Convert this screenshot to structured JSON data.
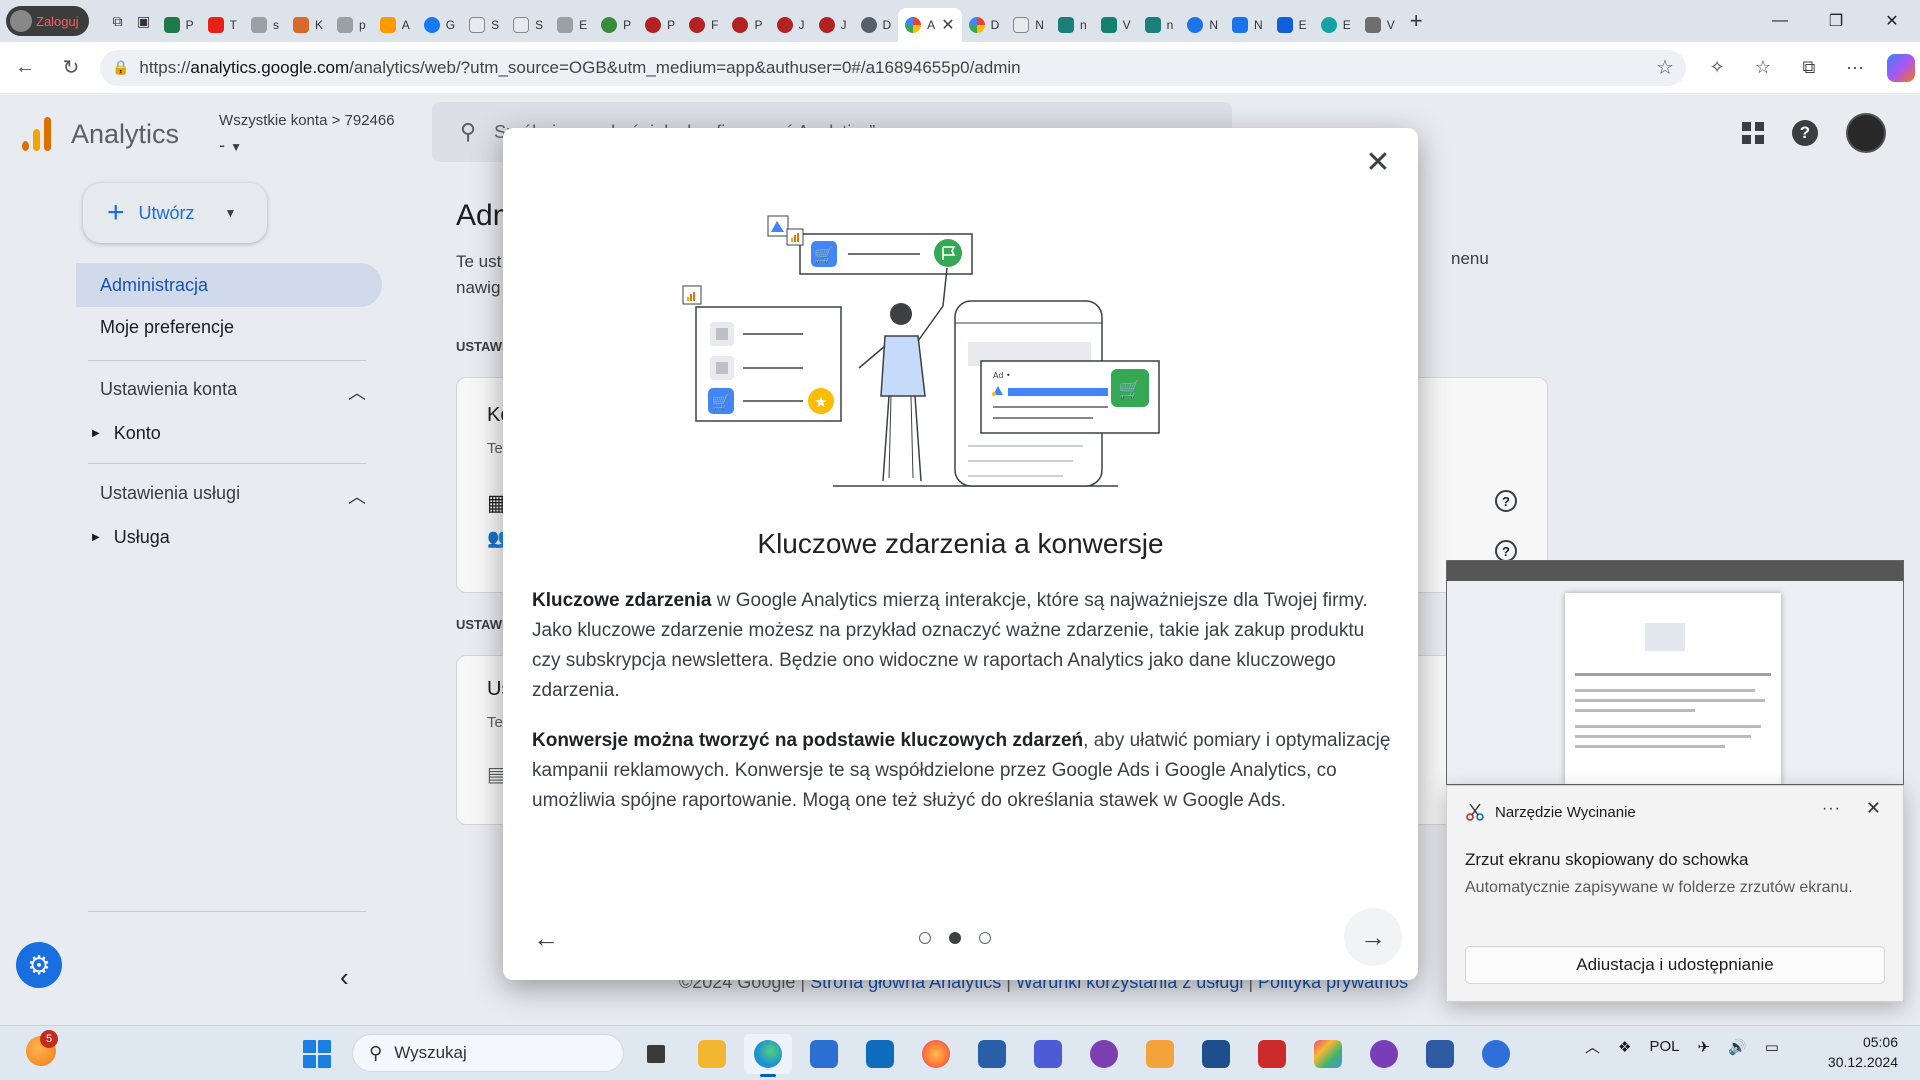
{
  "browser": {
    "profile_label": "Zaloguj",
    "pinned_tabs": [
      "P",
      "T",
      "s",
      "K",
      "p",
      "A",
      "G",
      "S",
      "S",
      "E",
      "P",
      "P",
      "F",
      "P",
      "J",
      "J",
      "D"
    ],
    "active_tab_title": "A",
    "right_tabs": [
      "D",
      "N",
      "n",
      "V",
      "n",
      "N",
      "N",
      "E",
      "E",
      "V"
    ],
    "url_prefix": "https://",
    "url_host": "analytics.google.com",
    "url_path": "/analytics/web/?utm_source=OGB&utm_medium=app&authuser=0#/a16894655p0/admin",
    "colors": {
      "tabstrip": "#dde3ea",
      "omnibox": "#edf0f4"
    }
  },
  "ga": {
    "app_title": "Analytics",
    "breadcrumb": "Wszystkie konta",
    "account_id": "792466",
    "property_value": "-",
    "search_placeholder": "Spróbuj wyszukać „jak skonfigurować Analytics”",
    "create_label": "Utwórz",
    "sidebar": {
      "admin": "Administracja",
      "prefs": "Moje preferencje",
      "account_settings": "Ustawienia konta",
      "account_item": "Konto",
      "service_settings": "Ustawienia usługi",
      "service_item": "Usługa"
    },
    "main": {
      "title_partial": "Adm",
      "desc_line1": "Te ust",
      "desc_line2": "nawig",
      "desc_right": "nenu",
      "section1": "USTAWI",
      "card1_title": "Ko",
      "card1_sub": "Te",
      "section2": "USTAWI",
      "card2_title": "Us",
      "card2_sub": "Te"
    },
    "footer": {
      "copyright": "©2024 Google",
      "link1": "Strona główna Analytics",
      "link2": "Warunki korzystania z usługi",
      "link3": "Polityka prywatnoś"
    },
    "accent_color": "#1a73e8"
  },
  "modal": {
    "title": "Kluczowe zdarzenia a konwersje",
    "p1_bold": "Kluczowe zdarzenia",
    "p1_rest": " w Google Analytics mierzą interakcje, które są najważniejsze dla Twojej firmy. Jako kluczowe zdarzenie możesz na przykład oznaczyć ważne zdarzenie, takie jak zakup produktu czy subskrypcja newslettera. Będzie ono widoczne w raportach Analytics jako dane kluczowego zdarzenia.",
    "p2_bold": "Konwersje można tworzyć na podstawie kluczowych zdarzeń",
    "p2_rest": ", aby ułatwić pomiary i optymalizację kampanii reklamowych. Konwersje te są współdzielone przez Google Ads i Google Analytics, co umożliwia spójne raportowanie. Mogą one też służyć do określania stawek w Google Ads.",
    "illustration_ad_label": "Ad •",
    "page_count": 3,
    "current_page": 2
  },
  "snip_toast": {
    "app_name": "Narzędzie Wycinanie",
    "title": "Zrzut ekranu skopiowany do schowka",
    "text": "Automatycznie zapisywane w folderze zrzutów ekranu.",
    "button": "Adiustacja i udostępnianie",
    "more": "···"
  },
  "taskbar": {
    "weather_badge": "5",
    "search_placeholder": "Wyszukaj",
    "language": "POL",
    "time": "05:06",
    "date": "30.12.2024",
    "apps": [
      {
        "name": "task-view",
        "color": "#3a3a3a"
      },
      {
        "name": "file-explorer",
        "color": "#f2b632"
      },
      {
        "name": "edge",
        "color": "#1d8fd6"
      },
      {
        "name": "store",
        "color": "#2a6fd1"
      },
      {
        "name": "outlook",
        "color": "#0f6cbd"
      },
      {
        "name": "firefox",
        "color": "#ff7139"
      },
      {
        "name": "photos",
        "color": "#2b5fa8"
      },
      {
        "name": "save-app",
        "color": "#4d5bd6"
      },
      {
        "name": "github",
        "color": "#7b3fb0"
      },
      {
        "name": "player",
        "color": "#f3a33a"
      },
      {
        "name": "virtualbox",
        "color": "#1e4f8c"
      },
      {
        "name": "terminal",
        "color": "#cc2b2b"
      },
      {
        "name": "app-diamond",
        "color": "#e8487d"
      },
      {
        "name": "tor",
        "color": "#7a3db8"
      },
      {
        "name": "network-app",
        "color": "#2f5ba3"
      },
      {
        "name": "app-blue",
        "color": "#2e6fd8"
      }
    ]
  }
}
